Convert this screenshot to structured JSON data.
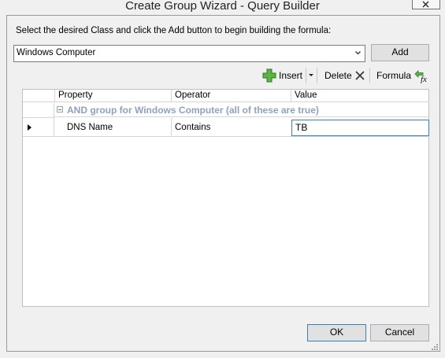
{
  "window": {
    "title": "Create Group Wizard - Query Builder"
  },
  "instruction": "Select the desired Class and click the Add button to begin building the formula:",
  "class_select": {
    "value": "Windows Computer"
  },
  "add_label": "Add",
  "toolbar": {
    "insert_label": "Insert",
    "delete_label": "Delete",
    "formula_label": "Formula"
  },
  "grid": {
    "columns": [
      "Property",
      "Operator",
      "Value"
    ],
    "group_label": "AND group for Windows Computer (all of these are true)",
    "rows": [
      {
        "property": "DNS Name",
        "operator": "Contains",
        "value": "TB"
      }
    ]
  },
  "footer": {
    "ok_label": "OK",
    "cancel_label": "Cancel"
  },
  "icons": [
    "close-icon",
    "chevron-down-icon",
    "insert-plus-icon",
    "delete-x-icon",
    "formula-icon",
    "row-pointer-icon",
    "collapse-icon",
    "resize-grip-icon"
  ]
}
